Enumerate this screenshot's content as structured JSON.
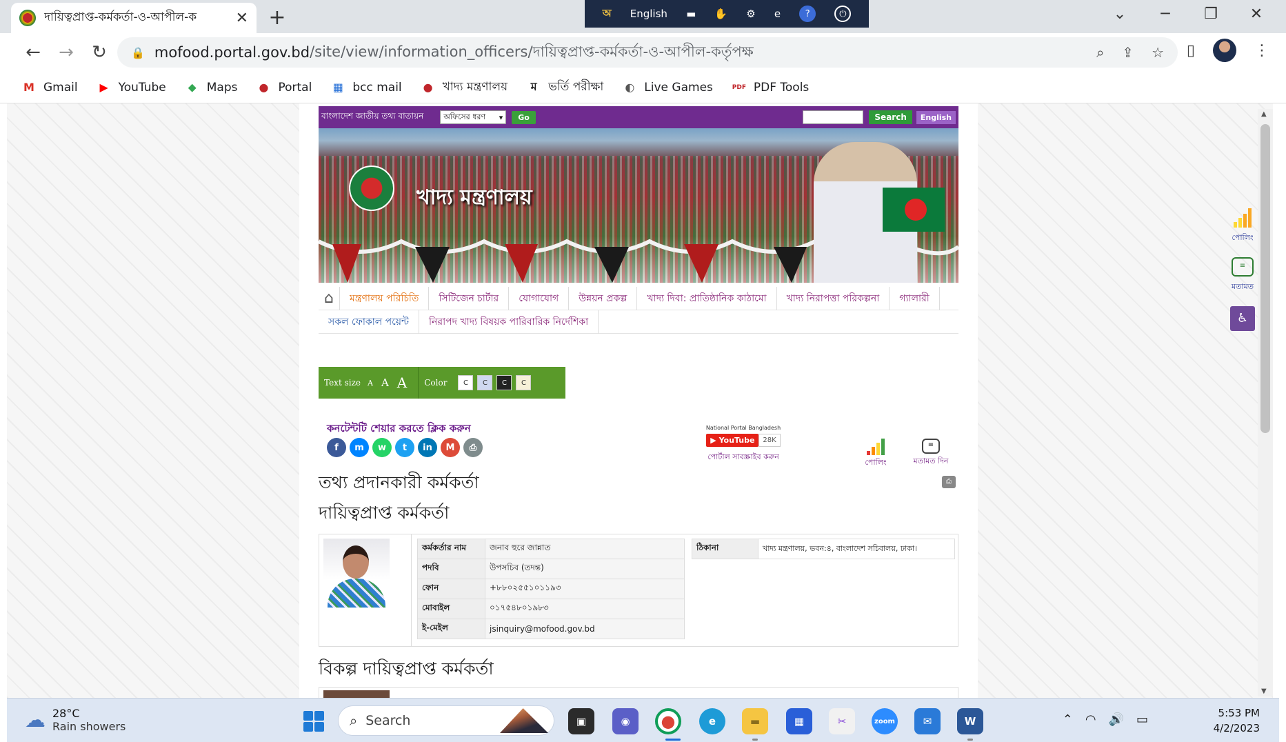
{
  "browser": {
    "tab_title": "দায়িত্বপ্রাপ্ত-কর্মকর্তা-ও-আপীল-ক",
    "close_tab": "✕",
    "new_tab": "+",
    "url_host": "mofood.portal.gov.bd",
    "url_path": "/site/view/information_officers/দায়িত্বপ্রাপ্ত-কর্মকর্তা-ও-আপীল-কর্তৃপক্ষ",
    "language_indicator": "English",
    "bookmarks": [
      {
        "label": "Gmail",
        "icon": "gmail-icon",
        "glyph": "M",
        "color": "#d93025"
      },
      {
        "label": "YouTube",
        "icon": "youtube-icon",
        "glyph": "▶",
        "color": "#ff0000"
      },
      {
        "label": "Maps",
        "icon": "maps-icon",
        "glyph": "⬥",
        "color": "#34a853"
      },
      {
        "label": "Portal",
        "icon": "portal-icon",
        "glyph": "●",
        "color": "#c0262b"
      },
      {
        "label": "bcc mail",
        "icon": "bcc-mail-icon",
        "glyph": "▦",
        "color": "#1e6bd6"
      },
      {
        "label": "খাদ্য মন্ত্রণালয়",
        "icon": "portal-icon",
        "glyph": "●",
        "color": "#c0262b"
      },
      {
        "label": "ভর্তি পরীক্ষা",
        "icon": "admission-icon",
        "glyph": "ম",
        "color": "#222222"
      },
      {
        "label": "Live Games",
        "icon": "games-icon",
        "glyph": "◐",
        "color": "#555555"
      },
      {
        "label": "PDF Tools",
        "icon": "pdf-icon",
        "glyph": "PDF",
        "color": "#c0262b"
      }
    ]
  },
  "site": {
    "portal_title": "বাংলাদেশ জাতীয় তথ্য বাতায়ন",
    "office_select": "অফিসের ধরণ",
    "go_label": "Go",
    "search_label": "Search",
    "english_label": "English",
    "ministry_name": "খাদ্য মন্ত্রণালয়",
    "nav_row1": [
      {
        "label": "মন্ত্রণালয় পরিচিতি",
        "style": "active"
      },
      {
        "label": "সিটিজেন চার্টার",
        "style": ""
      },
      {
        "label": "যোগাযোগ",
        "style": ""
      },
      {
        "label": "উন্নয়ন প্রকল্প",
        "style": ""
      },
      {
        "label": "খাদ্য দিবা: প্রাতিষ্ঠানিক কাঠামো",
        "style": ""
      },
      {
        "label": "খাদ্য নিরাপত্তা পরিকল্পনা",
        "style": ""
      },
      {
        "label": "গ্যালারী",
        "style": ""
      }
    ],
    "nav_row2": [
      {
        "label": "সকল ফোকাল পয়েন্ট",
        "style": "blue"
      },
      {
        "label": "নিরাপদ খাদ্য বিষয়ক পারিবারিক নির্দেশিকা",
        "style": ""
      }
    ],
    "text_size_label": "Text size",
    "text_sizes": [
      "A",
      "A",
      "A"
    ],
    "color_label": "Color",
    "color_swatches": [
      {
        "label": "C",
        "bg": "#ffffff",
        "fg": "#333333"
      },
      {
        "label": "C",
        "bg": "#cfd8f0",
        "fg": "#333333"
      },
      {
        "label": "C",
        "bg": "#222222",
        "fg": "#ffffff"
      },
      {
        "label": "C",
        "bg": "#f6f0d8",
        "fg": "#333333"
      }
    ],
    "share_label": "কনটেন্টটি শেয়ার করতে ক্লিক করুন",
    "share_icons": [
      {
        "name": "facebook-icon",
        "glyph": "f",
        "color": "#3b5998"
      },
      {
        "name": "messenger-icon",
        "glyph": "m",
        "color": "#0084ff"
      },
      {
        "name": "whatsapp-icon",
        "glyph": "w",
        "color": "#25d366"
      },
      {
        "name": "twitter-icon",
        "glyph": "t",
        "color": "#1da1f2"
      },
      {
        "name": "linkedin-icon",
        "glyph": "in",
        "color": "#0077b5"
      },
      {
        "name": "email-icon",
        "glyph": "M",
        "color": "#dd4b39"
      },
      {
        "name": "print-share-icon",
        "glyph": "⎙",
        "color": "#7f8c8d"
      }
    ],
    "np_title": "National Portal Bangladesh",
    "yt_label": "YouTube",
    "yt_subs": "28K",
    "np_subscribe": "পোর্টাল সাবস্ক্রাইব করুন",
    "poll_label": "পোলিং",
    "feedback_label": "মতামত দিন",
    "heading_info": "তথ্য প্রদানকারী কর্মকর্তা",
    "heading_responsible": "দায়িত্বপ্রাপ্ত কর্মকর্তা",
    "officer": {
      "rows": [
        {
          "k": "কর্মকর্তার নাম",
          "v": "জনাব হুরে জান্নাত"
        },
        {
          "k": "পদবি",
          "v": "উপসচিব (তদন্ত)"
        },
        {
          "k": "ফোন",
          "v": "+৮৮০২৫৫১০১১৯৩"
        },
        {
          "k": "মোবাইল",
          "v": "০১৭৫৪৮০১৯৮৩"
        },
        {
          "k": "ই-মেইল",
          "v": "jsinquiry@mofood.gov.bd"
        }
      ],
      "address_key": "ঠিকানা",
      "address_val": "খাদ্য মন্ত্রণালয়, ভবন:৪, বাংলাদেশ সচিবালয়, ঢাকা।"
    },
    "heading_alternate": "বিকল্প দায়িত্বপ্রাপ্ত কর্মকর্তা",
    "side_poll_label": "পোলিং",
    "side_feedback_label": "মতামত"
  },
  "taskbar": {
    "temperature": "28°C",
    "weather_desc": "Rain showers",
    "search_placeholder": "Search",
    "time": "5:53 PM",
    "date": "4/2/2023"
  }
}
